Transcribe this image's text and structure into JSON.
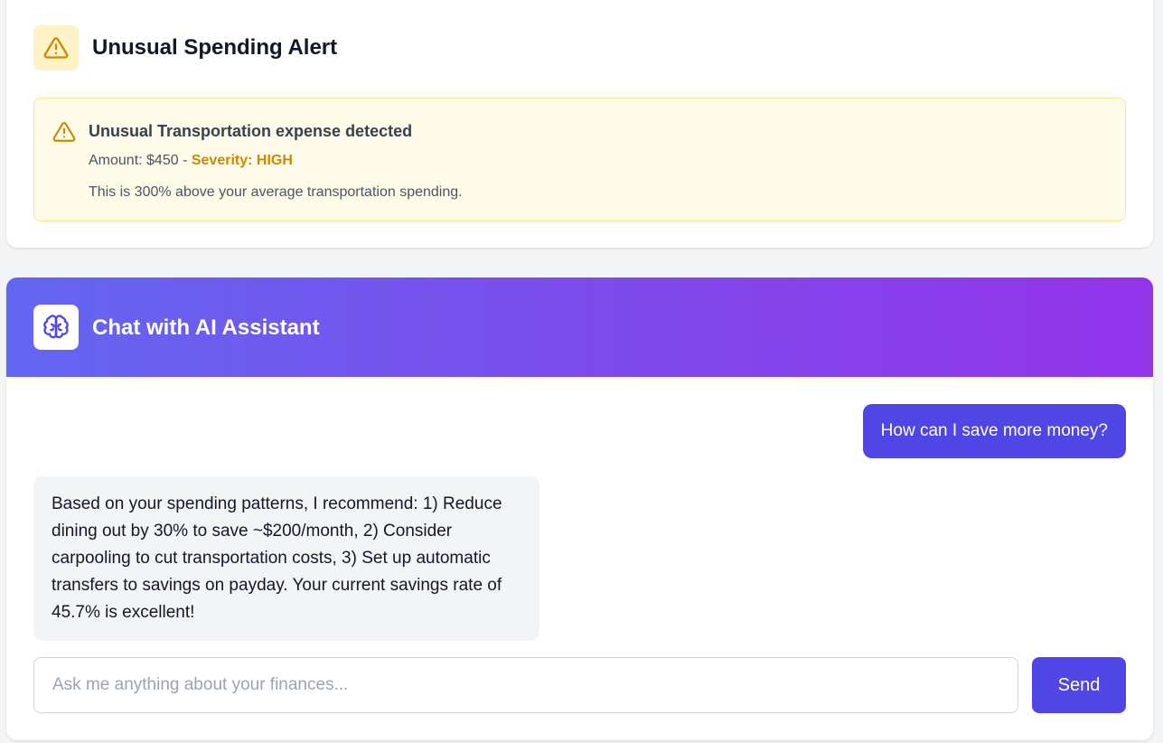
{
  "alert_card": {
    "title": "Unusual Spending Alert",
    "icon": "warning-triangle-icon",
    "alert": {
      "title": "Unusual Transportation expense detected",
      "amount_label": "Amount: $450 - ",
      "severity": "Severity: HIGH",
      "description": "This is 300% above your average transportation spending."
    }
  },
  "chat_card": {
    "title": "Chat with AI Assistant",
    "icon": "brain-icon",
    "messages": [
      {
        "role": "user",
        "text": "How can I save more money?"
      },
      {
        "role": "assistant",
        "text": "Based on your spending patterns, I recommend: 1) Reduce dining out by 30% to save ~$200/month, 2) Consider carpooling to cut transportation costs, 3) Set up automatic transfers to savings on payday. Your current savings rate of 45.7% is excellent!"
      }
    ],
    "input": {
      "placeholder": "Ask me anything about your finances...",
      "value": ""
    },
    "send_label": "Send"
  },
  "colors": {
    "accent": "#4f46e5",
    "gradient_start": "#6366f1",
    "gradient_end": "#9333ea",
    "warning": "#ca8a04",
    "warning_bg": "#fefce8"
  }
}
